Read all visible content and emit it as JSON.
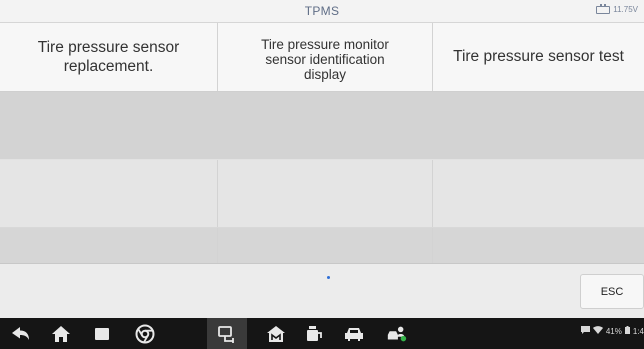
{
  "header": {
    "title": "TPMS",
    "battery_voltage": "11.75V"
  },
  "menu": {
    "items": [
      {
        "label": "Tire pressure sensor replacement."
      },
      {
        "label": "Tire pressure monitor sensor identification display"
      },
      {
        "label": "Tire pressure sensor test"
      }
    ]
  },
  "footer": {
    "esc_label": "ESC",
    "page_indicator": {
      "current": 1,
      "total": 1
    }
  },
  "navbar": {
    "icons": [
      "back-icon",
      "home-icon",
      "recent-apps-icon",
      "browser-icon",
      "vci-connection-icon",
      "maxifix-icon",
      "vehicle-service-icon",
      "car-icon",
      "remote-expert-icon"
    ],
    "status": {
      "battery_percent": "41%",
      "time": "1:4"
    }
  },
  "colors": {
    "title_text": "#5f6d86",
    "page_dot": "#2f6fd6",
    "navbar_bg": "#151515"
  }
}
